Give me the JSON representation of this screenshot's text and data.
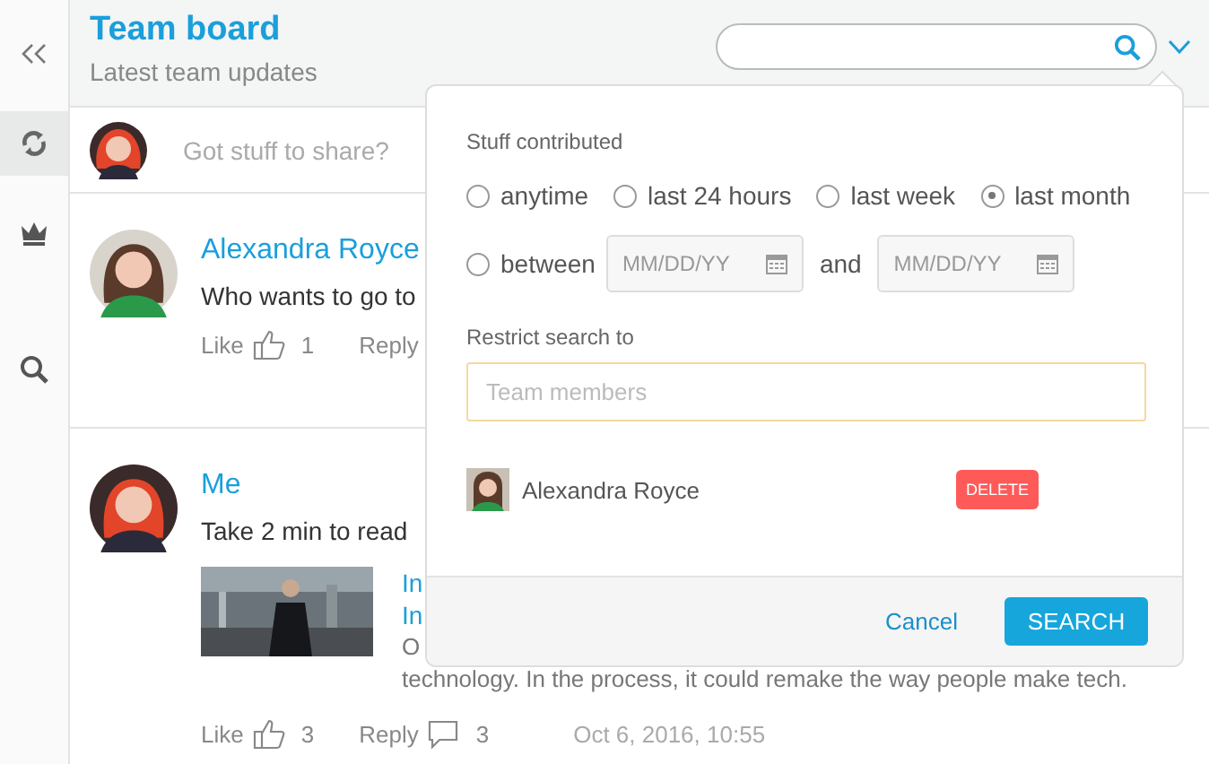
{
  "sidebar": {
    "items": [
      {
        "kind": "collapse",
        "selected": false
      },
      {
        "kind": "refresh",
        "selected": true
      },
      {
        "kind": "crown",
        "selected": false
      },
      {
        "kind": "search",
        "selected": false
      }
    ]
  },
  "header": {
    "title": "Team board",
    "subtitle": "Latest team updates"
  },
  "composer": {
    "placeholder": "Got stuff to share?"
  },
  "posts": [
    {
      "author": "Alexandra Royce",
      "text": "Who wants to go to",
      "like_label": "Like",
      "likes": "1",
      "reply_label": "Reply"
    },
    {
      "author": "Me",
      "text": "Take 2 min to read",
      "attachment": {
        "link_lines": [
          "In",
          "In"
        ],
        "excerpt_lines": [
          "O",
          "technology. In the process, it could remake the way people make tech."
        ]
      },
      "like_label": "Like",
      "likes": "3",
      "reply_label": "Reply",
      "replies": "3",
      "date": "Oct 6, 2016, 10:55"
    }
  ],
  "search_popup": {
    "section_label": "Stuff contributed",
    "periods": [
      {
        "label": "anytime",
        "selected": false
      },
      {
        "label": "last 24 hours",
        "selected": false
      },
      {
        "label": "last week",
        "selected": false
      },
      {
        "label": "last month",
        "selected": true
      }
    ],
    "between": {
      "label": "between",
      "selected": false,
      "from_placeholder": "MM/DD/YY",
      "joiner": "and",
      "to_placeholder": "MM/DD/YY"
    },
    "restrict_label": "Restrict search to",
    "members_placeholder": "Team members",
    "members": [
      {
        "name": "Alexandra Royce",
        "action": "DELETE"
      }
    ],
    "cancel": "Cancel",
    "submit": "SEARCH"
  }
}
